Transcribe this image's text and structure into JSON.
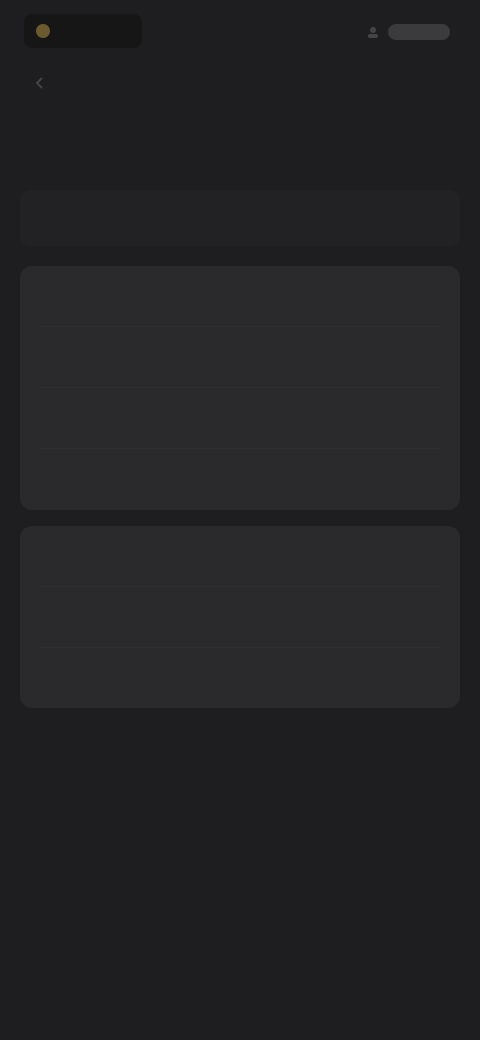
{
  "header": {
    "logo_text": "",
    "action_label": ""
  },
  "back_link": "",
  "page_title": "",
  "tab": {
    "active_label": ""
  },
  "account_section": {
    "rows": [
      {
        "label": "",
        "value": ""
      },
      {
        "label": "",
        "value": ""
      },
      {
        "label": "",
        "value": ""
      },
      {
        "label": "",
        "value": ""
      }
    ]
  },
  "preferences_section": {
    "rows": [
      {
        "label": "",
        "value": ""
      },
      {
        "label": "",
        "value": ""
      },
      {
        "label": "",
        "value": ""
      }
    ]
  },
  "colors": {
    "background": "#1e1e20",
    "card": "#2a2a2c",
    "title_text": "#c8c8c8",
    "logo_accent": "#6b5a2e"
  }
}
